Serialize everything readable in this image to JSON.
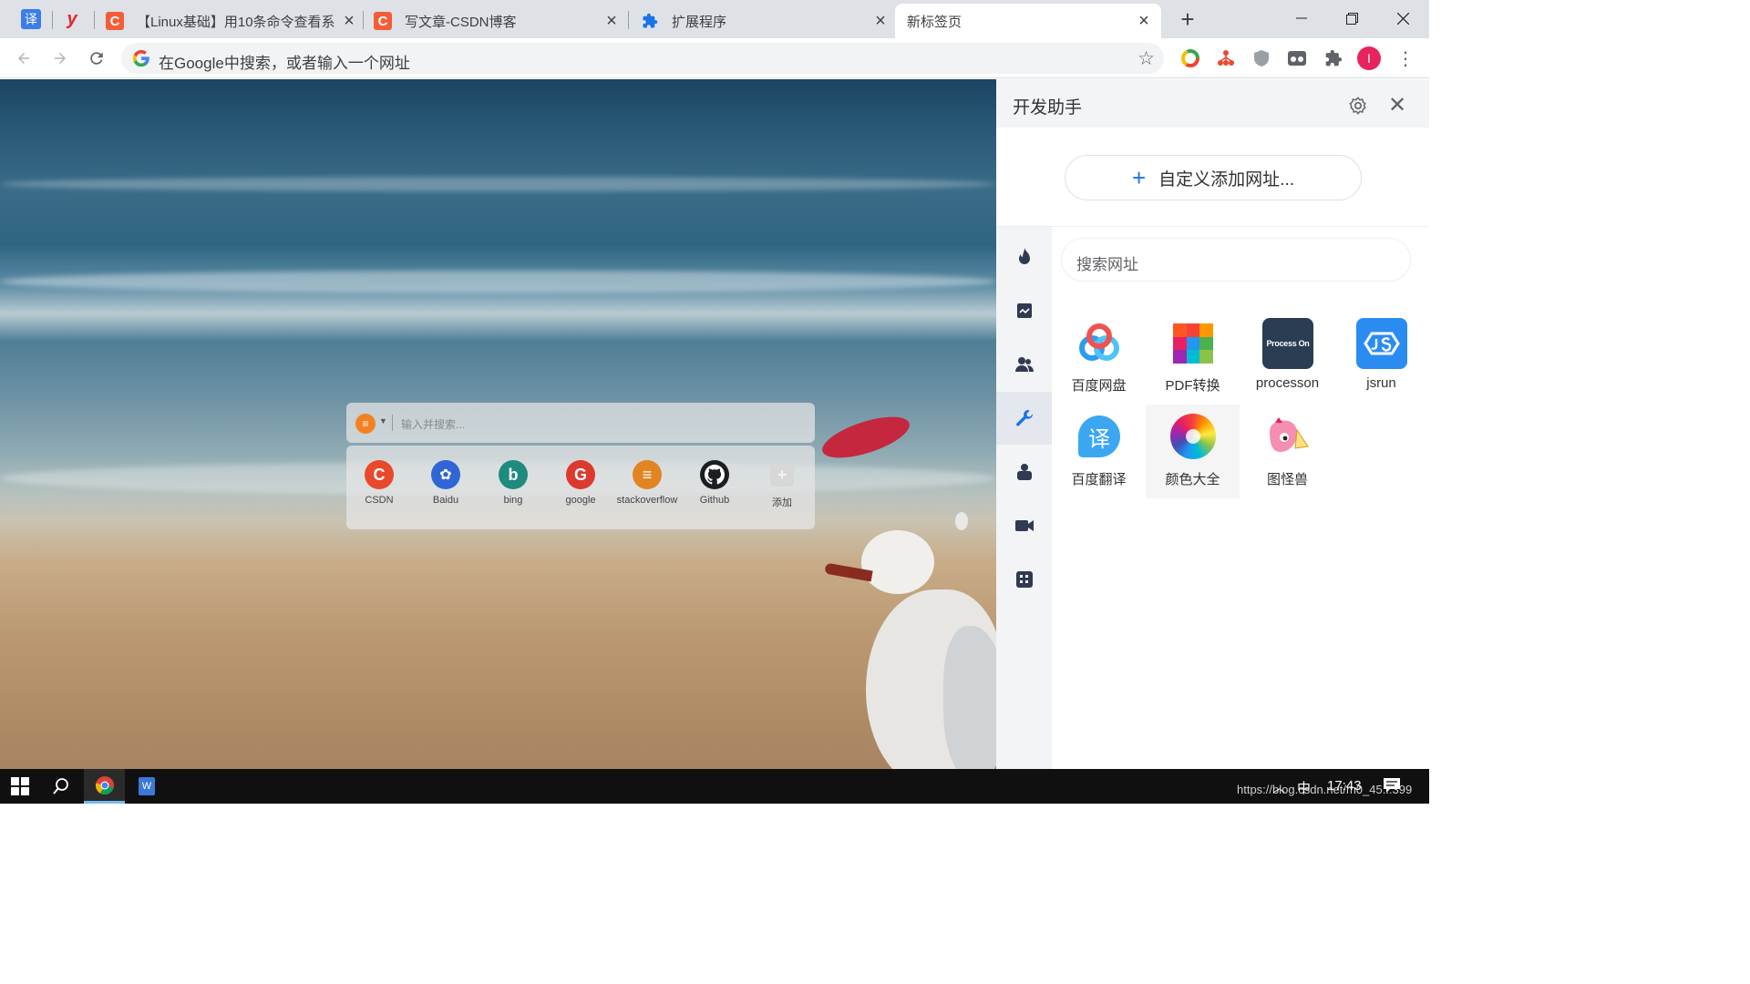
{
  "tabs": [
    {
      "title": "【Linux基础】用10条命令查看系",
      "favicon": "csdn-icon"
    },
    {
      "title": "写文章-CSDN博客",
      "favicon": "csdn-icon"
    },
    {
      "title": "扩展程序",
      "favicon": "puzzle-icon"
    },
    {
      "title": "新标签页",
      "favicon": "none",
      "active": true
    }
  ],
  "pinned_tabs": [
    {
      "glyph": "译",
      "icon": "translate-icon"
    },
    {
      "glyph": "y",
      "icon": "youdao-icon"
    }
  ],
  "toolbar": {
    "omnibox_placeholder": "在Google中搜索，或者输入一个网址",
    "profile_initial": "I"
  },
  "ntp": {
    "search_placeholder": "输入并搜索...",
    "quick_links": [
      {
        "label": "CSDN",
        "glyph": "C",
        "color": "#e8492c"
      },
      {
        "label": "Baidu",
        "glyph": "✿",
        "color": "#3165d6"
      },
      {
        "label": "bing",
        "glyph": "b",
        "color": "#1f8b7d"
      },
      {
        "label": "google",
        "glyph": "G",
        "color": "#db3b2f"
      },
      {
        "label": "stackoverflow",
        "glyph": "≡",
        "color": "#e08522"
      },
      {
        "label": "Github",
        "glyph": "",
        "color": "#1b1f23"
      },
      {
        "label": "添加",
        "glyph": "+",
        "color": "#d7d7d7"
      }
    ]
  },
  "panel": {
    "title": "开发助手",
    "add_label": "自定义添加网址...",
    "search_placeholder": "搜索网址",
    "rail": [
      "fire-icon",
      "chart-icon",
      "users-icon",
      "tools-icon",
      "person-icon",
      "video-icon",
      "calculator-icon"
    ],
    "active_rail_index": 3,
    "sites": [
      {
        "name": "百度网盘",
        "icon": "baidu-netdisk-icon"
      },
      {
        "name": "PDF转换",
        "icon": "pdf-convert-icon"
      },
      {
        "name": "processon",
        "icon": "processon-icon",
        "logo_text": "Process On"
      },
      {
        "name": "jsrun",
        "icon": "jsrun-icon"
      },
      {
        "name": "百度翻译",
        "icon": "baidu-translate-icon",
        "logo_text": "译"
      },
      {
        "name": "颜色大全",
        "icon": "color-wheel-icon"
      },
      {
        "name": "图怪兽",
        "icon": "tuguaishou-icon"
      }
    ]
  },
  "taskbar": {
    "ime": "中",
    "clock": "17:43",
    "url_watermark": "https://blog.csdn.net/m0_45...399"
  },
  "colors": {
    "tabstrip": "#dee1e6",
    "accent": "#1a73e8",
    "taskbar": "#101010",
    "csdn": "#f45d37"
  }
}
